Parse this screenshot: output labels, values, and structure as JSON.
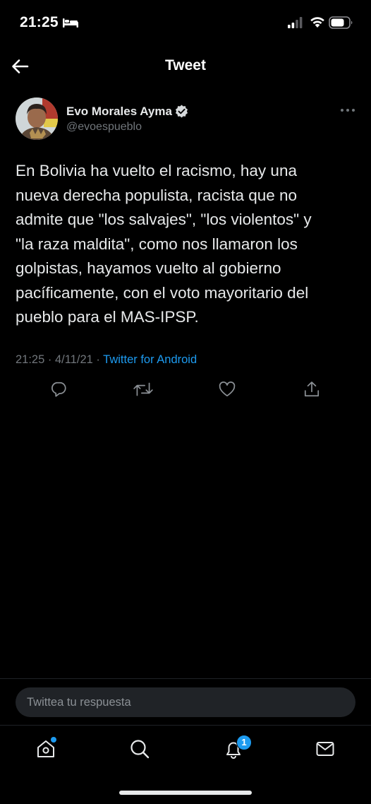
{
  "status_bar": {
    "time": "21:25",
    "icons": [
      "bed-icon",
      "signal-icon",
      "wifi-icon",
      "battery-icon"
    ]
  },
  "header": {
    "title": "Tweet",
    "back_icon": "back-arrow-icon"
  },
  "tweet": {
    "author_name": "Evo Morales Ayma",
    "author_handle": "@evoespueblo",
    "verified": true,
    "text": "En Bolivia ha vuelto el racismo, hay una\nnueva derecha populista, racista que no\nadmite que \"los salvajes\", \"los violentos\" y\n\"la raza maldita\", como nos llamaron los\ngolpistas, hayamos vuelto al gobierno\npacíficamente, con el voto mayoritario del\npueblo para el MAS-IPSP.",
    "time": "21:25",
    "separator": " · ",
    "date": "4/11/21",
    "source": "Twitter for Android",
    "actions": [
      "reply-icon",
      "retweet-icon",
      "like-icon",
      "share-icon"
    ]
  },
  "reply": {
    "placeholder": "Twittea tu respuesta"
  },
  "bottom_nav": {
    "items": [
      "home-icon",
      "search-icon",
      "notifications-icon",
      "messages-icon"
    ],
    "notifications_badge": "1"
  },
  "colors": {
    "background": "#000000",
    "text": "#e7e9ea",
    "secondary": "#71767b",
    "accent": "#1d9bf0"
  }
}
